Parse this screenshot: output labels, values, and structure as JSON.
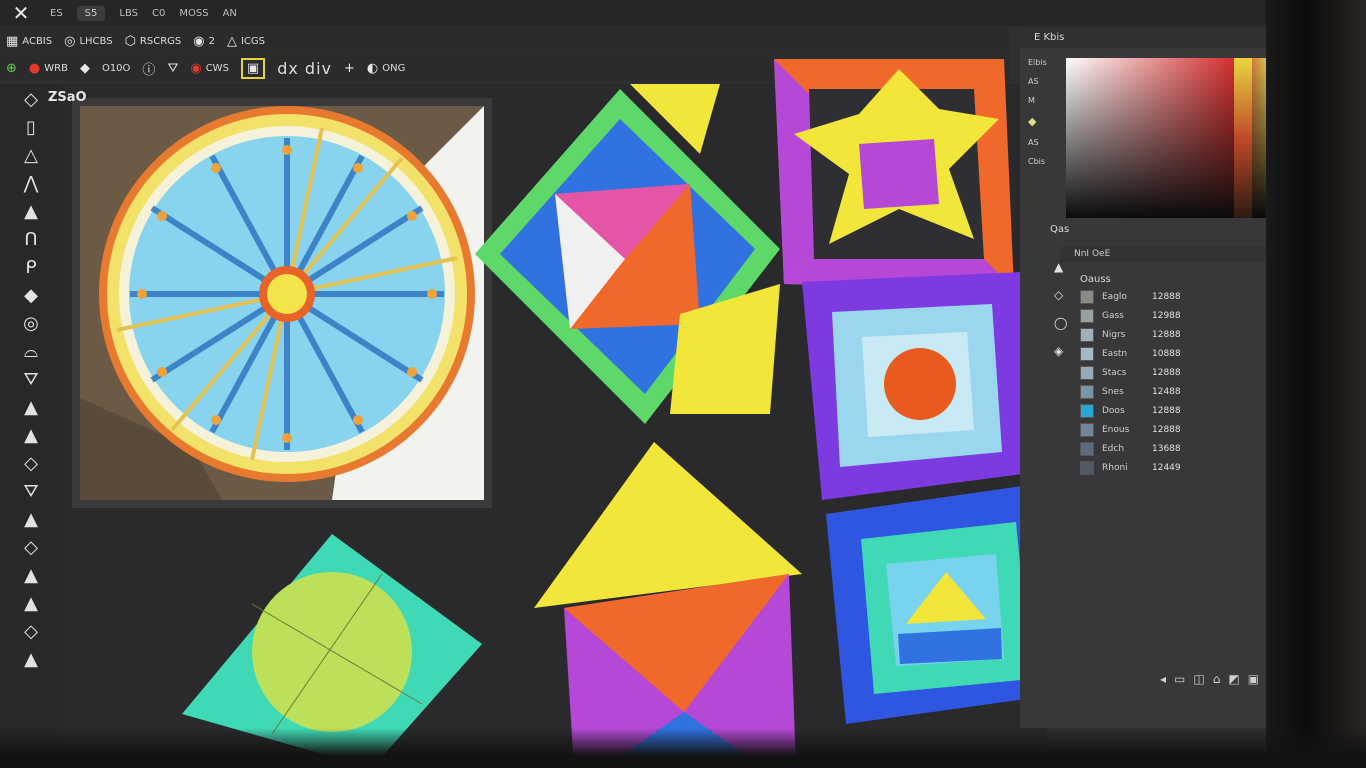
{
  "menubar": {
    "logo": "✕",
    "tab_label": "S5",
    "items": [
      "ES",
      "LBS",
      "C0",
      "MOSS",
      "AN"
    ]
  },
  "toolbar1": {
    "items": [
      {
        "icon": "grid-icon",
        "glyph": "▦",
        "label": "ACBIS"
      },
      {
        "icon": "brush-icon",
        "glyph": "◎",
        "label": "LHCBS"
      },
      {
        "icon": "layers-icon",
        "glyph": "⬡",
        "label": "RSCRGS"
      },
      {
        "icon": "target-icon",
        "glyph": "◉",
        "label": "2"
      },
      {
        "icon": "pen-icon",
        "glyph": "△",
        "label": "ICGS"
      }
    ]
  },
  "toolbar2": {
    "items": [
      {
        "icon": "snap-icon",
        "glyph": "⊕",
        "label": ""
      },
      {
        "icon": "record-icon",
        "glyph": "●",
        "label": "WRB"
      },
      {
        "icon": "shape-icon",
        "glyph": "◆",
        "label": ""
      },
      {
        "icon": "zoom-icon",
        "glyph": "",
        "label": "O10O"
      },
      {
        "icon": "info-icon",
        "glyph": "ⓘ",
        "label": ""
      },
      {
        "icon": "tri-icon",
        "glyph": "⛛",
        "label": ""
      },
      {
        "icon": "eye-icon",
        "glyph": "◉",
        "label": "CWS"
      },
      {
        "icon": "lock-icon",
        "glyph": "▣",
        "label": ""
      },
      {
        "icon": "text-icon",
        "glyph": "",
        "label": "dx div"
      },
      {
        "icon": "plus-icon",
        "glyph": "+",
        "label": ""
      },
      {
        "icon": "camera-icon",
        "glyph": "◐",
        "label": "ONG"
      }
    ]
  },
  "document": {
    "tab_title": "ZSaO"
  },
  "left_tools": [
    "◇",
    "▯",
    "△",
    "⋀",
    "▲",
    "ᑎ",
    "ᑭ",
    "◆",
    "◎",
    "⌓",
    "⛛",
    "▲",
    "▲",
    "◇",
    "⛛",
    "▲",
    "◇",
    "▲",
    "▲",
    "◇",
    "▲"
  ],
  "right_panel": {
    "header": "E Kbis",
    "side_labels": [
      "Eibis",
      "AS",
      "M",
      "AS",
      "Cbis"
    ],
    "layers_head": "Qas",
    "layers_sub": "NnI OeE",
    "layers_title": "Oauss",
    "layers": [
      {
        "name": "Eaglo",
        "value": "12888",
        "color": "#8a8a86"
      },
      {
        "name": "Gass",
        "value": "12988",
        "color": "#9aa0a2"
      },
      {
        "name": "Nigrs",
        "value": "12888",
        "color": "#9fb0bb"
      },
      {
        "name": "Eastn",
        "value": "10888",
        "color": "#a3bac6"
      },
      {
        "name": "Stacs",
        "value": "12888",
        "color": "#94aab8"
      },
      {
        "name": "Snes",
        "value": "12488",
        "color": "#7d93a6"
      },
      {
        "name": "Doos",
        "value": "12888",
        "color": "#2aa7d8"
      },
      {
        "name": "Enous",
        "value": "12888",
        "color": "#73859a"
      },
      {
        "name": "Edch",
        "value": "13688",
        "color": "#5d6c7c"
      },
      {
        "name": "Rhoni",
        "value": "12449",
        "color": "#4e5a67"
      }
    ]
  },
  "status_icons": [
    "◂",
    "▭",
    "◫",
    "⌂",
    "◩",
    "▣",
    "⬒",
    "⌗",
    "⧉"
  ],
  "colors": {
    "yellow": "#f2e63a",
    "orange": "#f0682a",
    "magenta": "#b548d6",
    "blue": "#2f72e0",
    "green": "#5fd86a",
    "teal": "#3fd9b5",
    "sky": "#78d3ef"
  }
}
